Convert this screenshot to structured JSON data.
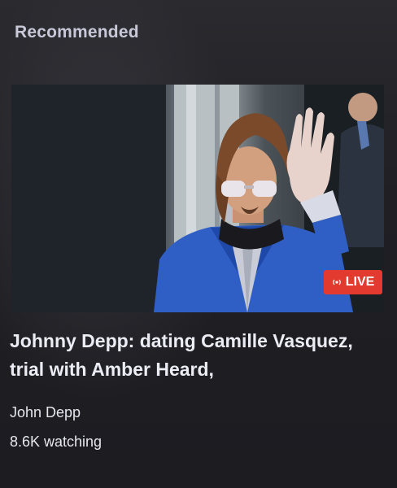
{
  "section": {
    "title": "Recommended"
  },
  "video": {
    "title": "Johnny Depp: dating Camille Vasquez, trial with Amber Heard,",
    "channel": "John Depp",
    "watching": "8.6K watching",
    "thumbnail_icon": "video-thumbnail",
    "badge": {
      "label": "LIVE",
      "icon": "live-broadcast-icon",
      "color": "#e23a2e"
    }
  },
  "colors": {
    "background": "#1f1f24",
    "section_title": "#c8c8d8",
    "text": "#ececf4"
  }
}
